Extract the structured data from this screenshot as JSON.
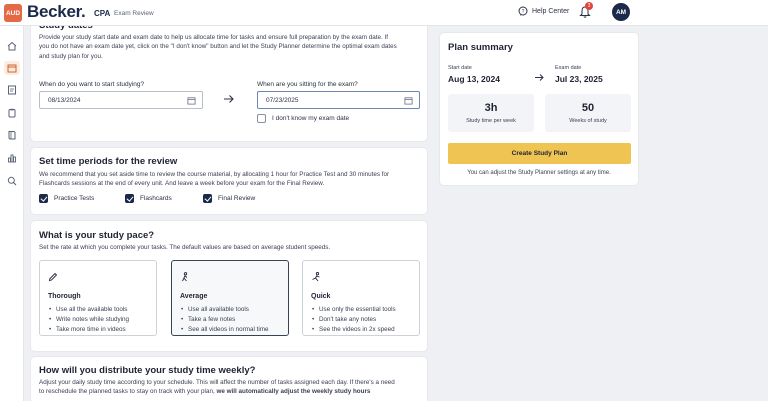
{
  "header": {
    "aud_badge": "AUD",
    "brand": "Becker.",
    "product": "CPA",
    "product_sub": "Exam Review",
    "help_center": "Help Center",
    "notification_count": "3",
    "avatar_initials": "AM"
  },
  "sidebar": {
    "items": [
      "home-icon",
      "calendar-icon",
      "study-icon",
      "tasks-icon",
      "book-icon",
      "stats-icon",
      "search-icon"
    ]
  },
  "study_dates": {
    "title": "Study dates",
    "description_1": "Provide your study start date and exam date to help us allocate time for tasks and ensure full preparation by the exam date. If",
    "description_2": "you do not have an exam date yet, click on the \"I don't know\" button and let the Study Planner determine the optimal exam dates",
    "description_3": "and study plan for you.",
    "start_label": "When do you want to start studying?",
    "start_value": "08/13/2024",
    "exam_label": "When are you sitting for the exam?",
    "exam_value": "07/23/2025",
    "dont_know_label": "I don't know my exam date"
  },
  "time_periods": {
    "title": "Set time periods for the review",
    "description_1": "We recommend that you set aside time to review the course material, by allocating 1 hour for Practice Test and 30 minutes for",
    "description_2": "Flashcards sessions at the end of every unit. And leave a week before your exam for the Final Review.",
    "options": [
      "Practice Tests",
      "Flashcards",
      "Final Review"
    ]
  },
  "study_pace": {
    "title": "What is your study pace?",
    "description": "Set the rate at which you complete your tasks. The default values are based on average student speeds.",
    "options": [
      {
        "title": "Thorough",
        "items": [
          "Use all the available tools",
          "Write notes while studying",
          "Take more time in videos"
        ]
      },
      {
        "title": "Average",
        "items": [
          "Use all available tools",
          "Take a few notes",
          "See all videos in normal time"
        ]
      },
      {
        "title": "Quick",
        "items": [
          "Use only the essential tools",
          "Don't take any notes",
          "See the videos in 2x speed"
        ]
      }
    ]
  },
  "distribute": {
    "title": "How will you distribute your study time weekly?",
    "description_1": "Adjust your daily study time according to your schedule. This will affect the number of tasks assigned each day. If there's a need",
    "description_2": "to reschedule the planned tasks to stay on track with your plan,",
    "description_bold": "we will automatically adjust the weekly study hours"
  },
  "plan_summary": {
    "title": "Plan summary",
    "start_label": "Start date",
    "start_value": "Aug 13, 2024",
    "exam_label": "Exam date",
    "exam_value": "Jul 23, 2025",
    "time_value": "3h",
    "time_label": "Study time per week",
    "weeks_value": "50",
    "weeks_label": "Weeks of study",
    "button": "Create Study Plan",
    "note": "You can adjust the Study Planner settings at any time."
  }
}
